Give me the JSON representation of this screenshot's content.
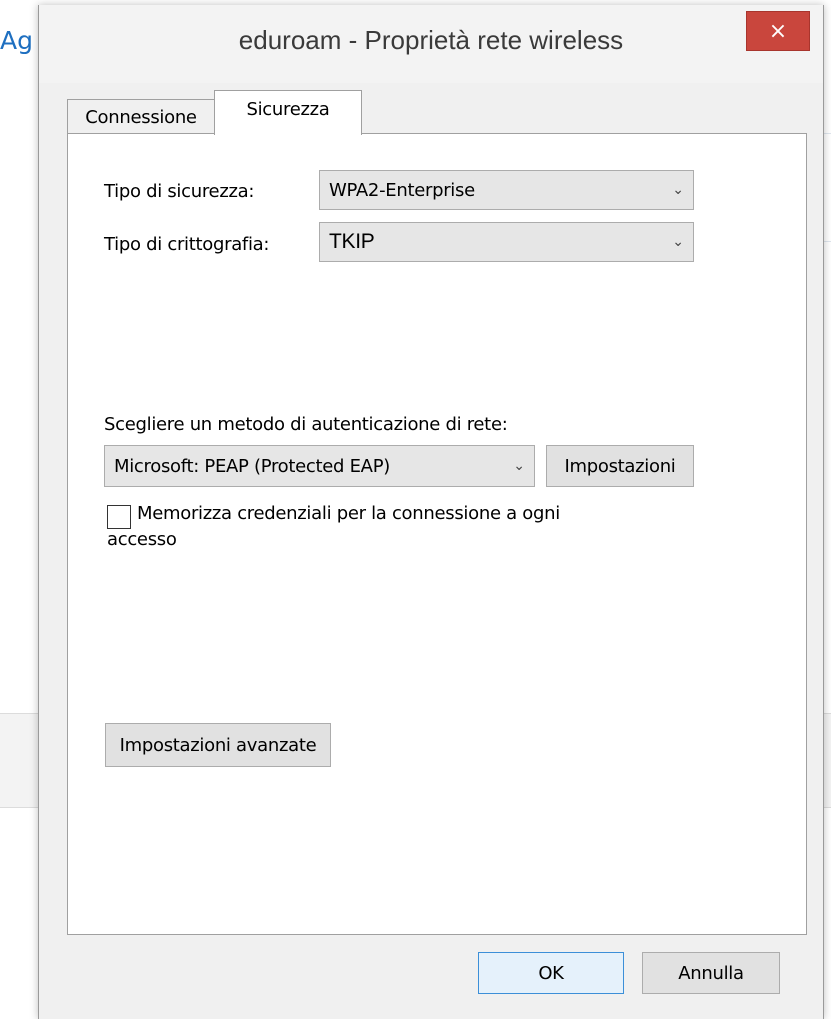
{
  "background": {
    "partial_text": "Ag"
  },
  "dialog": {
    "title": "eduroam - Proprietà rete wireless",
    "close_glyph": "×",
    "colors": {
      "close_button": "#c9463d",
      "panel": "#ffffff",
      "chrome": "#f0f0f0"
    },
    "tabs": [
      {
        "label": "Connessione",
        "active": false
      },
      {
        "label": "Sicurezza",
        "active": true
      }
    ],
    "security": {
      "type_label": "Tipo di sicurezza:",
      "type_value": "WPA2-Enterprise",
      "encryption_label": "Tipo di crittografia:",
      "encryption_value": "TKIP",
      "auth_method_label": "Scegliere un metodo di autenticazione di rete:",
      "auth_method_value": "Microsoft: PEAP (Protected EAP)",
      "settings_button": "Impostazioni",
      "remember_credentials_label_line1": "Memorizza credenziali per la connessione a ogni",
      "remember_credentials_label_line2": "accesso",
      "remember_credentials_checked": false,
      "advanced_button": "Impostazioni avanzate"
    },
    "footer": {
      "ok_label": "OK",
      "cancel_label": "Annulla"
    },
    "icons": {
      "dropdown": "chevron-down-icon",
      "close": "close-icon"
    }
  }
}
